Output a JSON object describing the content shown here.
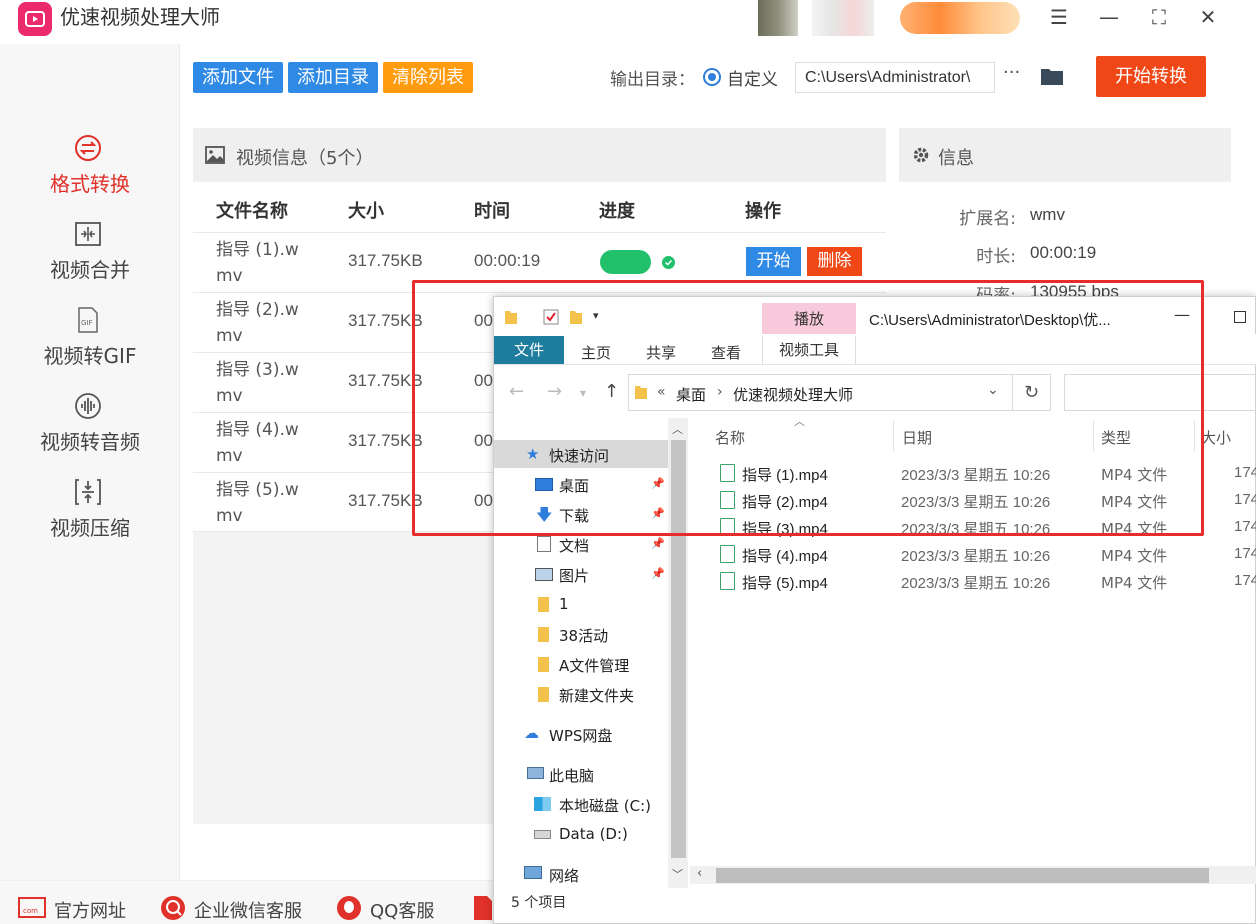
{
  "app": {
    "title": "优速视频处理大师"
  },
  "sidebar": {
    "items": [
      {
        "label": "格式转换",
        "icon": "swap-circle-icon"
      },
      {
        "label": "视频合并",
        "icon": "merge-icon"
      },
      {
        "label": "视频转GIF",
        "icon": "gif-icon"
      },
      {
        "label": "视频转音频",
        "icon": "audio-wave-icon"
      },
      {
        "label": "视频压缩",
        "icon": "compress-icon"
      }
    ]
  },
  "toolbar": {
    "add_file": "添加文件",
    "add_dir": "添加目录",
    "clear_list": "清除列表",
    "output_label": "输出目录：",
    "custom_label": "自定义",
    "output_path": "C:\\Users\\Administrator\\",
    "more": "···",
    "start": "开始转换"
  },
  "colors": {
    "accent_red": "#f04717",
    "blue": "#2f8ae6",
    "orange": "#ff9b0f",
    "sidebar_active": "#e0312a"
  },
  "video_panel": {
    "title": "视频信息（5个）",
    "columns": [
      "文件名称",
      "大小",
      "时间",
      "进度",
      "操作"
    ],
    "rows": [
      {
        "name": "指导 (1).wmv",
        "size": "317.75KB",
        "time": "00:00:19"
      },
      {
        "name": "指导 (2).wmv",
        "size": "317.75KB",
        "time": "00"
      },
      {
        "name": "指导 (3).wmv",
        "size": "317.75KB",
        "time": "00"
      },
      {
        "name": "指导 (4).wmv",
        "size": "317.75KB",
        "time": "00"
      },
      {
        "name": "指导 (5).wmv",
        "size": "317.75KB",
        "time": "00"
      }
    ],
    "progress_done": 1.0,
    "start_btn": "开始",
    "delete_btn": "删除"
  },
  "info_panel": {
    "title": "信息",
    "fields": [
      {
        "key": "扩展名:",
        "value": "wmv"
      },
      {
        "key": "时长:",
        "value": "00:00:19"
      },
      {
        "key": "码率:",
        "value": "130955 bps"
      }
    ]
  },
  "footer": {
    "items": [
      "官方网址",
      "企业微信客服",
      "QQ客服"
    ]
  },
  "explorer": {
    "title_path": "C:\\Users\\Administrator\\Desktop\\优...",
    "tabs": {
      "file": "文件",
      "home": "主页",
      "share": "共享",
      "view": "查看",
      "play": "播放",
      "video_tools": "视频工具"
    },
    "breadcrumb": [
      "桌面",
      "优速视频处理大师"
    ],
    "tree": {
      "quick_access": "快速访问",
      "items": [
        "桌面",
        "下载",
        "文档",
        "图片",
        "1",
        "38活动",
        "A文件管理",
        "新建文件夹"
      ],
      "wps": "WPS网盘",
      "this_pc": "此电脑",
      "drives": [
        "本地磁盘 (C:)",
        "Data (D:)"
      ],
      "network": "网络"
    },
    "columns": [
      "名称",
      "日期",
      "类型",
      "大小"
    ],
    "files": [
      {
        "name": "指导 (1).mp4",
        "date": "2023/3/3 星期五 10:26",
        "type": "MP4 文件",
        "size": "174"
      },
      {
        "name": "指导 (2).mp4",
        "date": "2023/3/3 星期五 10:26",
        "type": "MP4 文件",
        "size": "174"
      },
      {
        "name": "指导 (3).mp4",
        "date": "2023/3/3 星期五 10:26",
        "type": "MP4 文件",
        "size": "174"
      },
      {
        "name": "指导 (4).mp4",
        "date": "2023/3/3 星期五 10:26",
        "type": "MP4 文件",
        "size": "174"
      },
      {
        "name": "指导 (5).mp4",
        "date": "2023/3/3 星期五 10:26",
        "type": "MP4 文件",
        "size": "174"
      }
    ],
    "status": "5 个项目"
  }
}
